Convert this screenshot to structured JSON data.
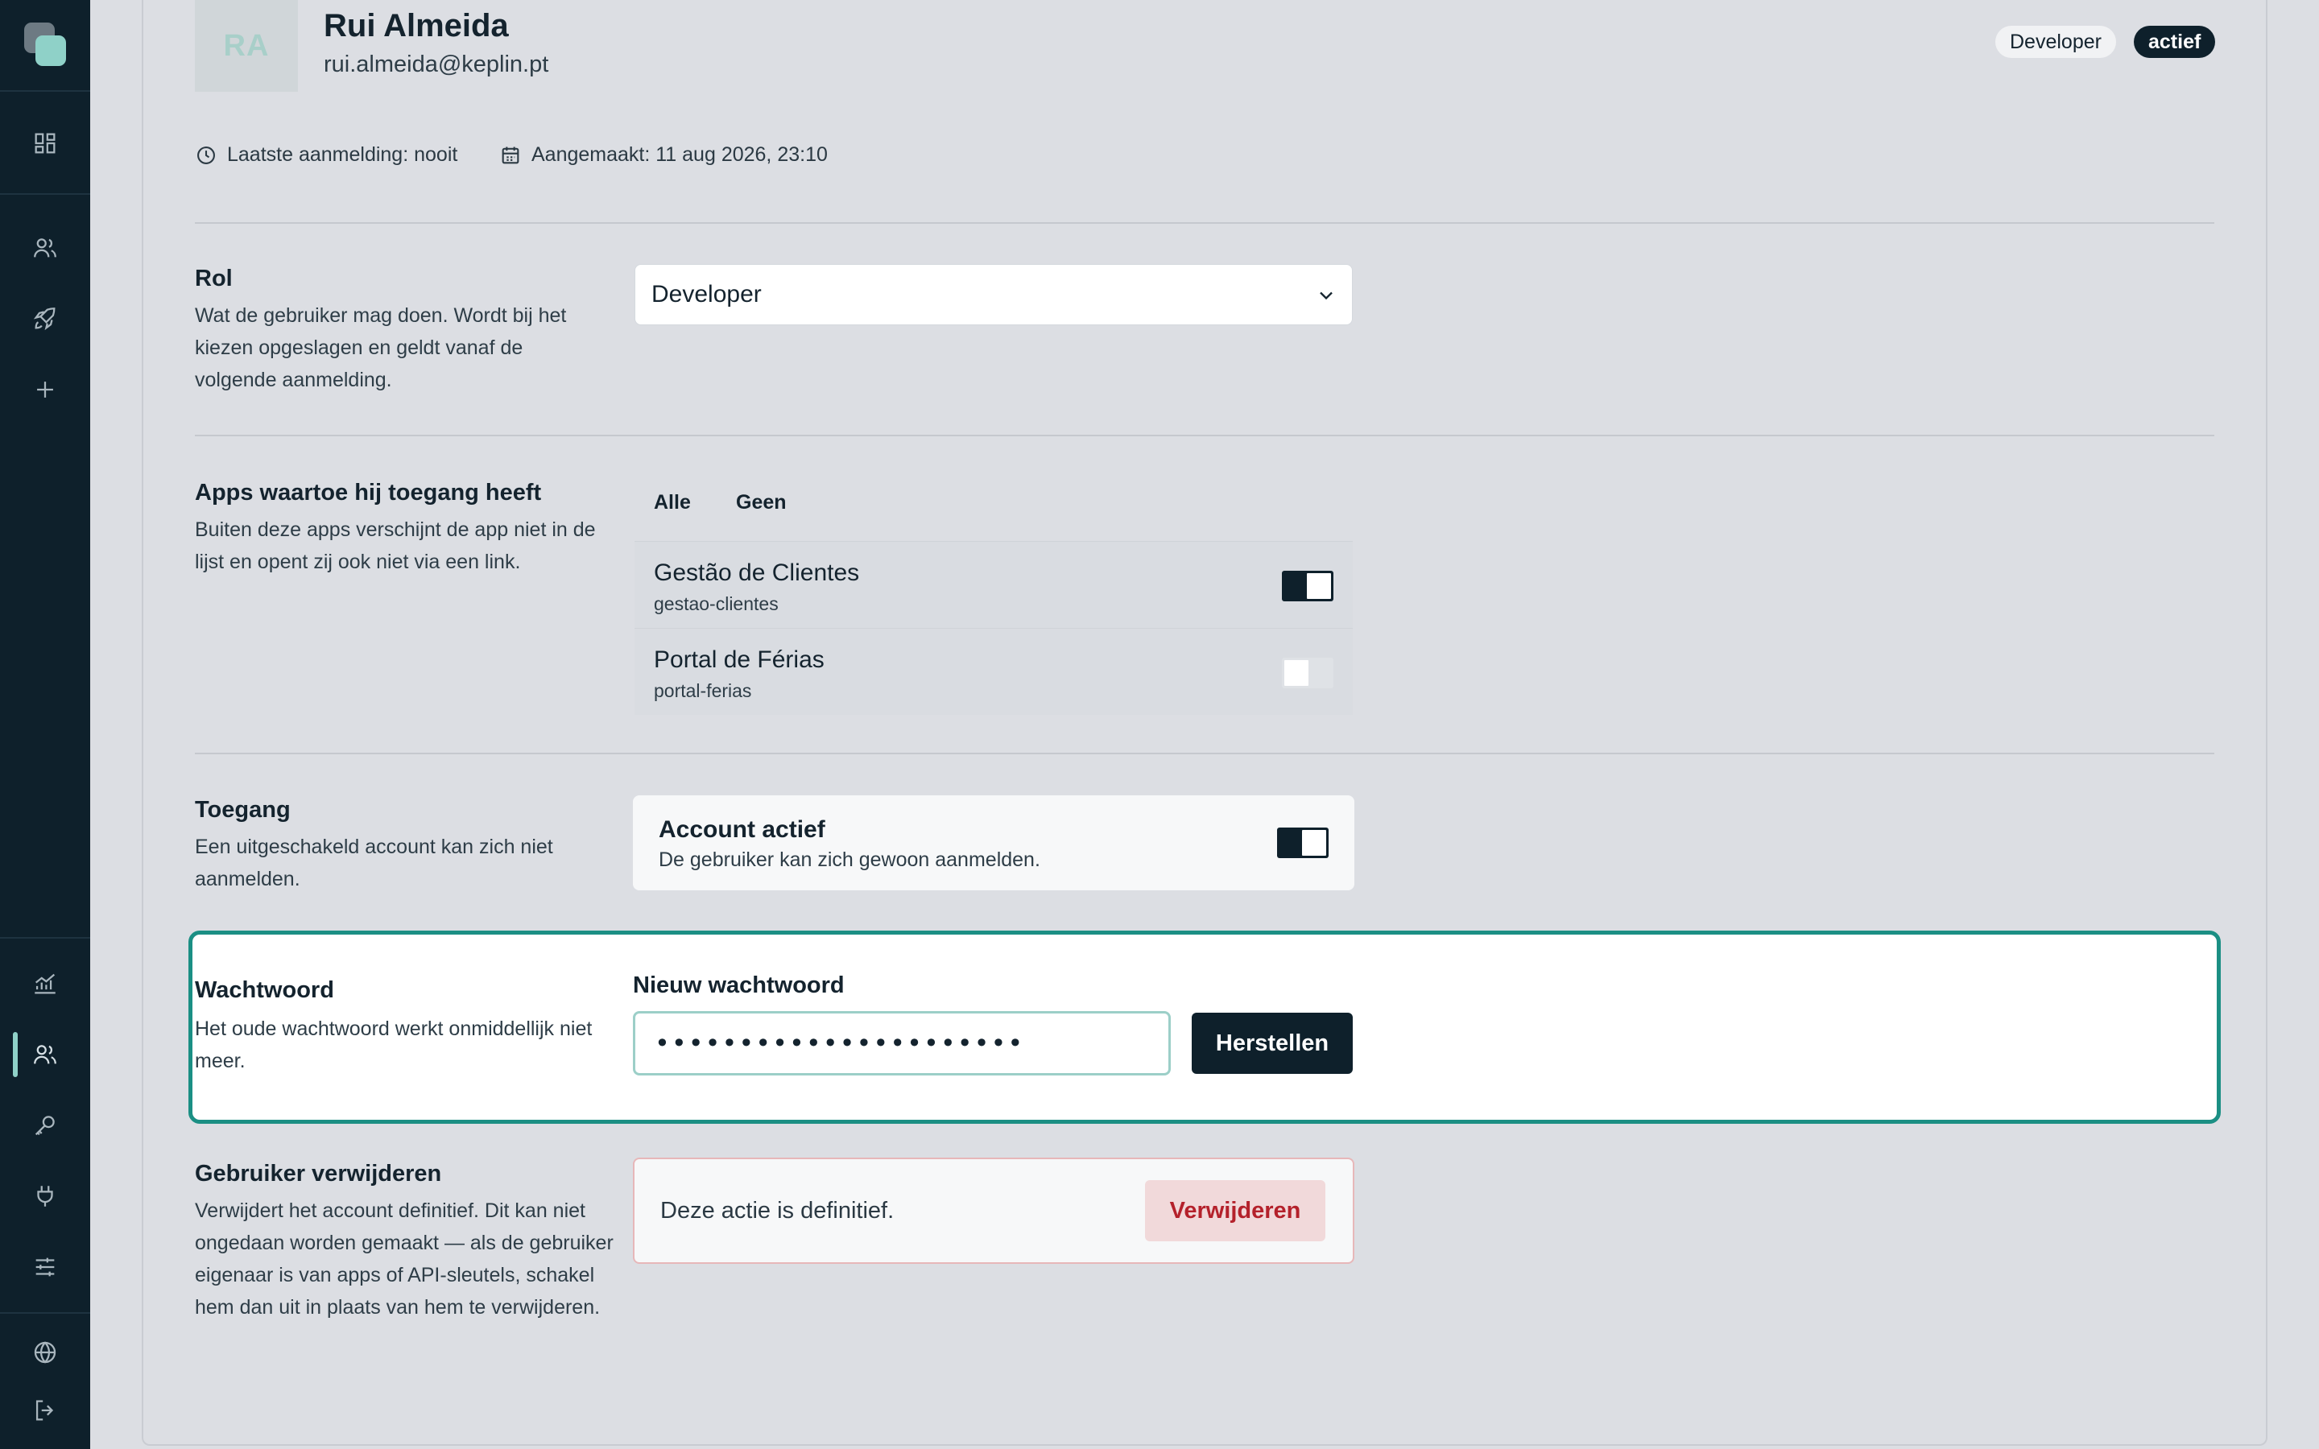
{
  "user": {
    "initials": "RA",
    "name": "Rui Almeida",
    "email": "rui.almeida@keplin.pt",
    "role_badge": "Developer",
    "status_badge": "actief",
    "last_login": "Laatste aanmelding: nooit",
    "created": "Aangemaakt: 11 aug 2026, 23:10"
  },
  "role": {
    "title": "Rol",
    "description": "Wat de gebruiker mag doen. Wordt bij het kiezen opgeslagen en geldt vanaf de volgende aanmelding.",
    "selected": "Developer"
  },
  "apps": {
    "title": "Apps waartoe hij toegang heeft",
    "description": "Buiten deze apps verschijnt de app niet in de lijst en opent zij ook niet via een link.",
    "select_all": "Alle",
    "select_none": "Geen",
    "items": [
      {
        "name": "Gestão de Clientes",
        "slug": "gestao-clientes",
        "enabled": true
      },
      {
        "name": "Portal de Férias",
        "slug": "portal-ferias",
        "enabled": false
      }
    ]
  },
  "access": {
    "title": "Toegang",
    "description": "Een uitgeschakeld account kan zich niet aanmelden.",
    "card_title": "Account actief",
    "card_desc": "De gebruiker kan zich gewoon aanmelden.",
    "enabled": true
  },
  "password": {
    "title": "Wachtwoord",
    "description": "Het oude wachtwoord werkt onmiddellijk niet meer.",
    "field_label": "Nieuw wachtwoord",
    "value": "••••••••••••••••••••••",
    "button": "Herstellen"
  },
  "delete": {
    "title": "Gebruiker verwijderen",
    "description": "Verwijdert het account definitief. Dit kan niet ongedaan worden gemaakt — als de gebruiker eigenaar is van apps of API-sleutels, schakel hem dan uit in plaats van hem te verwijderen.",
    "card_text": "Deze actie is definitief.",
    "button": "Verwijderen"
  },
  "colors": {
    "sidebar": "#0e202b",
    "accent": "#1b8f84",
    "danger": "#b4212b"
  },
  "icons": {
    "nav_top": [
      "dashboard-icon",
      "users-icon",
      "rocket-icon",
      "plus-icon"
    ],
    "nav_bottom": [
      "analytics-icon",
      "users-icon",
      "key-icon",
      "plug-icon",
      "sliders-icon",
      "globe-icon",
      "logout-icon"
    ]
  }
}
